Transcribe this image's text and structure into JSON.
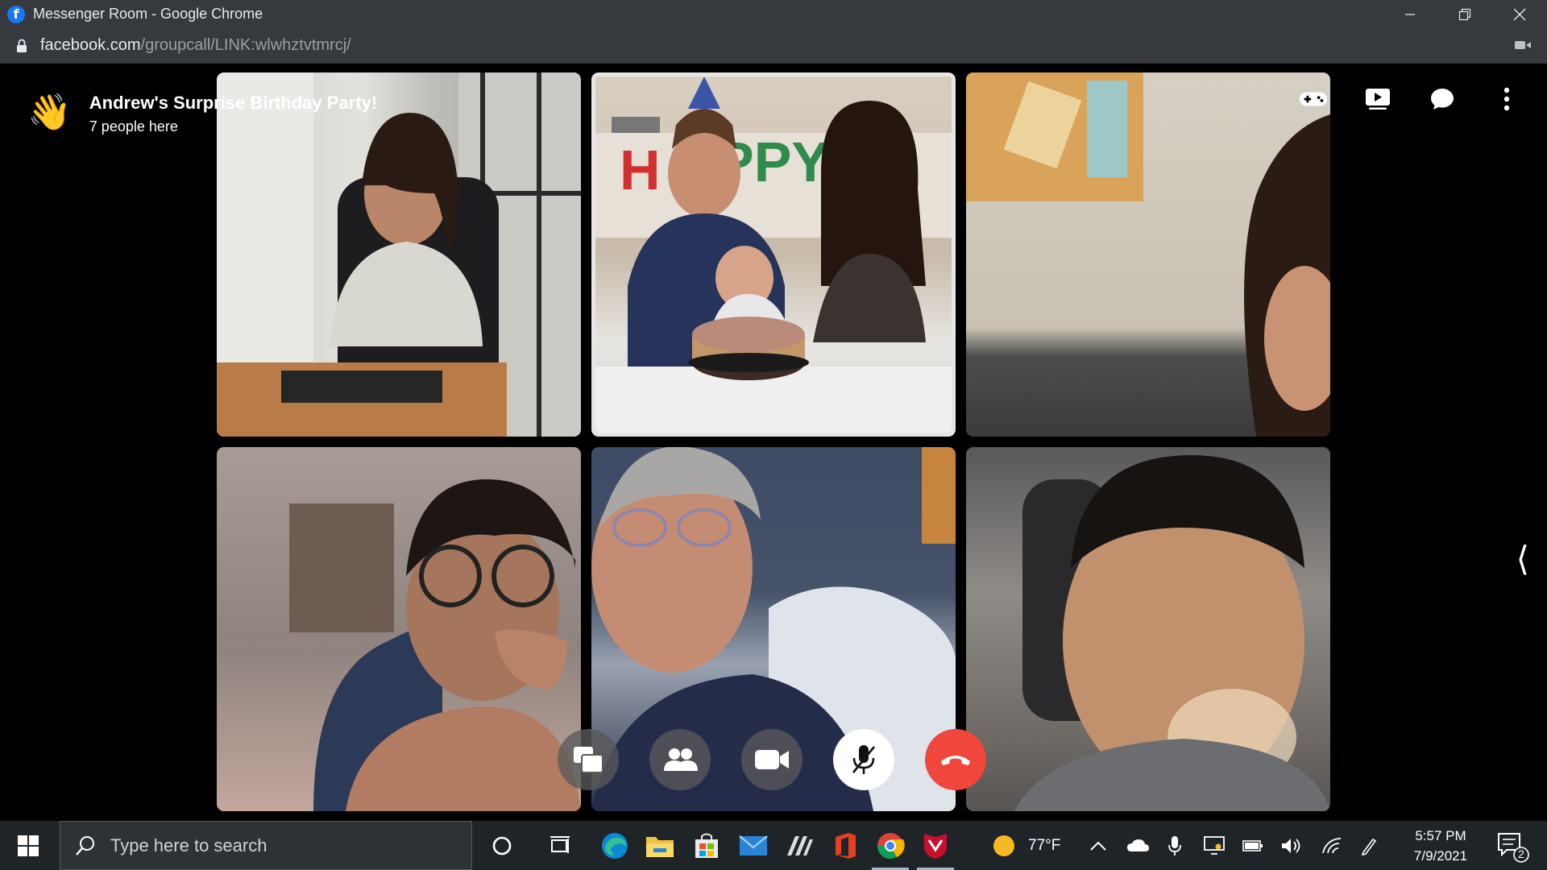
{
  "window": {
    "title": "Messenger Room - Google Chrome",
    "favicon": "facebook-f-icon",
    "controls": [
      "minimize-icon",
      "restore-icon",
      "close-icon"
    ]
  },
  "address_bar": {
    "host": "facebook.com",
    "path": "/groupcall/LINK:wlwhztvtmrcj/"
  },
  "room": {
    "title": "Andrew's Surprise Birthday Party!",
    "subtitle": "7 people here",
    "top_actions": [
      "games-icon",
      "watch-together-icon",
      "chat-icon",
      "more-options-icon"
    ],
    "participants": [
      {
        "tile": 1,
        "description": "woman at desk"
      },
      {
        "tile": 2,
        "description": "family with birthday cake",
        "active_speaker": true
      },
      {
        "tile": 3,
        "description": "partial face by wall"
      },
      {
        "tile": 4,
        "description": "woman with headphones"
      },
      {
        "tile": 5,
        "description": "man on couch"
      },
      {
        "tile": 6,
        "description": "man in car"
      }
    ],
    "controls": [
      {
        "name": "screen-share-icon",
        "label": "Share screen"
      },
      {
        "name": "participants-icon",
        "label": "People"
      },
      {
        "name": "video-camera-icon",
        "label": "Camera"
      },
      {
        "name": "microphone-muted-icon",
        "label": "Unmute"
      },
      {
        "name": "end-call-icon",
        "label": "End call"
      }
    ]
  },
  "taskbar": {
    "search_placeholder": "Type here to search",
    "weather": "77°F",
    "time": "5:57 PM",
    "date": "7/9/2021",
    "notification_count": "2"
  },
  "colors": {
    "chrome_bar": "#36393d",
    "end_call": "#f0463c",
    "taskbar": "#1f2428",
    "facebook_blue": "#1877f2"
  }
}
